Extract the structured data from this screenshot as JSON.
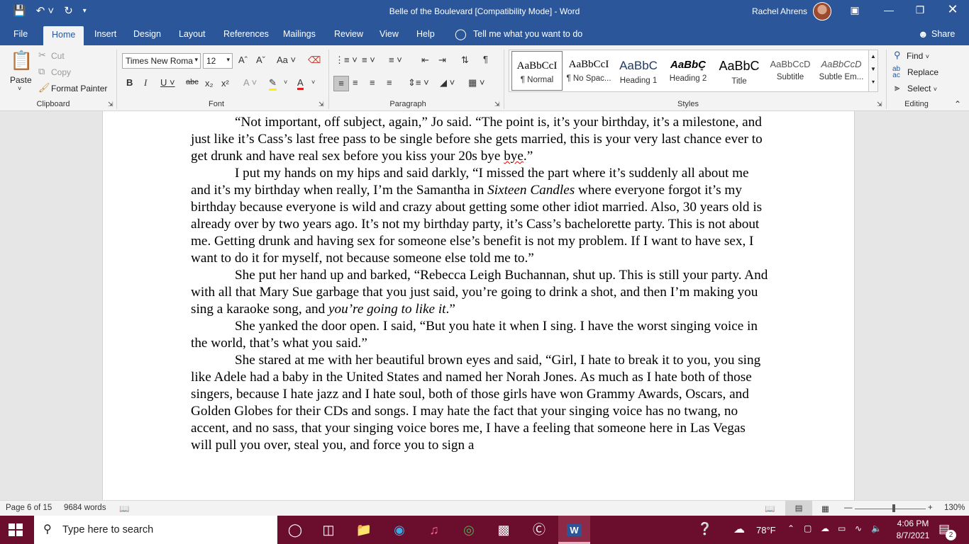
{
  "titlebar": {
    "doc_title": "Belle of the Boulevard [Compatibility Mode]  -  Word",
    "user_name": "Rachel Ahrens"
  },
  "tabs": [
    "File",
    "Home",
    "Insert",
    "Design",
    "Layout",
    "References",
    "Mailings",
    "Review",
    "View",
    "Help"
  ],
  "tell_me": "Tell me what you want to do",
  "share": "Share",
  "ribbon": {
    "clipboard": {
      "paste": "Paste",
      "cut": "Cut",
      "copy": "Copy",
      "format_painter": "Format Painter",
      "label": "Clipboard"
    },
    "font": {
      "name": "Times New Roma",
      "size": "12",
      "label": "Font"
    },
    "paragraph": {
      "label": "Paragraph"
    },
    "styles": {
      "label": "Styles",
      "items": [
        {
          "preview": "AaBbCcI",
          "name": "¶ Normal"
        },
        {
          "preview": "AaBbCcI",
          "name": "¶ No Spac..."
        },
        {
          "preview": "AaBbC",
          "name": "Heading 1"
        },
        {
          "preview": "AaBbC͈",
          "name": "Heading 2"
        },
        {
          "preview": "AaBbC",
          "name": "Title"
        },
        {
          "preview": "AaBbCcD",
          "name": "Subtitle"
        },
        {
          "preview": "AaBbCcD",
          "name": "Subtle Em..."
        }
      ]
    },
    "editing": {
      "find": "Find",
      "replace": "Replace",
      "select": "Select",
      "label": "Editing"
    }
  },
  "document": {
    "paragraphs": [
      "“Not important, off subject, again,” Jo said. “The point is, it’s your birthday, it’s a milestone, and just like it’s Cass’s last free pass to be single before she gets married, this is your very last chance ever to get drunk and have real sex before you kiss your 20s bye ",
      "I put my hands on my hips and said darkly, “I missed the part where it’s suddenly all about me and it’s my birthday when really, I’m the Samantha in ",
      "She put her hand up and barked, “Rebecca Leigh Buchannan, shut up. This is still your party. And with all that Mary Sue garbage that you just said, you’re going to drink a shot, and then I’m making you sing a karaoke song, and ",
      "She yanked the door open. I said, “But you hate it when I sing. I have the worst singing voice in the world, that’s what you said.”",
      "She stared at me with her beautiful brown eyes and said, “Girl, I hate to break it to you, you sing like Adele had a baby in the United States and named her Norah Jones. As much as I hate both of those singers, because I hate jazz and I hate soul, both of those girls have won Grammy Awards, Oscars, and Golden Globes for their CDs and songs. I may hate the fact that your singing voice has no twang, no accent, and no sass, that your singing voice bores me, I have a feeling that someone here in Las Vegas will pull you over, steal you, and force you to sign a"
    ],
    "p1_squiggle": "bye",
    "p1_end": ".”",
    "p2_italic": "Sixteen Candles",
    "p2_end": " where everyone forgot it’s my birthday because everyone is wild and crazy about getting some other idiot married. Also, 30 years old is already over by two years ago. It’s not my birthday party, it’s Cass’s bachelorette party. This is not about me. Getting drunk and having sex for someone else’s benefit is not my problem. If I want to have sex, I want to do it for myself, not because someone else told me to.”",
    "p3_italic": "you’re going to like it",
    "p3_end": ".”"
  },
  "status": {
    "page": "Page 6 of 15",
    "words": "9684 words",
    "zoom": "130%",
    "zoom_fraction": 0.55
  },
  "taskbar": {
    "search_placeholder": "Type here to search",
    "weather": "78°F",
    "time": "4:06 PM",
    "date": "8/7/2021",
    "notifications": "2"
  }
}
